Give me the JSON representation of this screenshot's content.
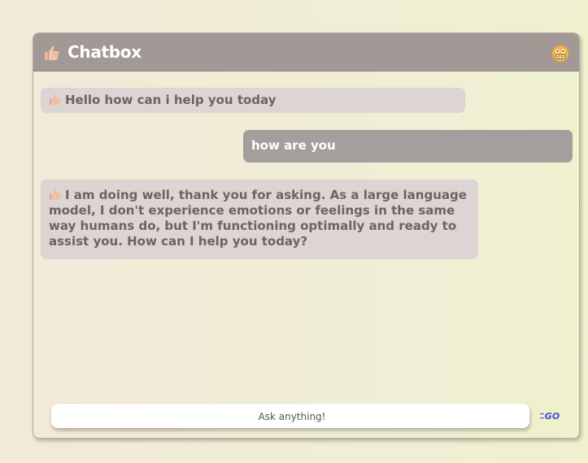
{
  "header": {
    "title": "Chatbox",
    "logo_icon": "thumbs-up-icon",
    "status_icon": "grimace-emoji-icon"
  },
  "messages": [
    {
      "sender": "bot",
      "text": "Hello how can i help you today",
      "icon": "thumbs-up-icon"
    },
    {
      "sender": "user",
      "text": "how are you"
    },
    {
      "sender": "bot",
      "text": "I am doing well, thank you for asking. As a large language model, I don't experience emotions or feelings in the same way humans do, but I'm functioning optimally and ready to assist you. How can I help you today?",
      "icon": "thumbs-up-icon"
    }
  ],
  "composer": {
    "placeholder": "Ask anything!",
    "value": "",
    "send_label": "GO"
  },
  "colors": {
    "header_bg": "#a29896",
    "bot_bubble": "#ddd5d3",
    "user_bubble": "#a29f9d",
    "send_accent": "#4a4ad8"
  }
}
